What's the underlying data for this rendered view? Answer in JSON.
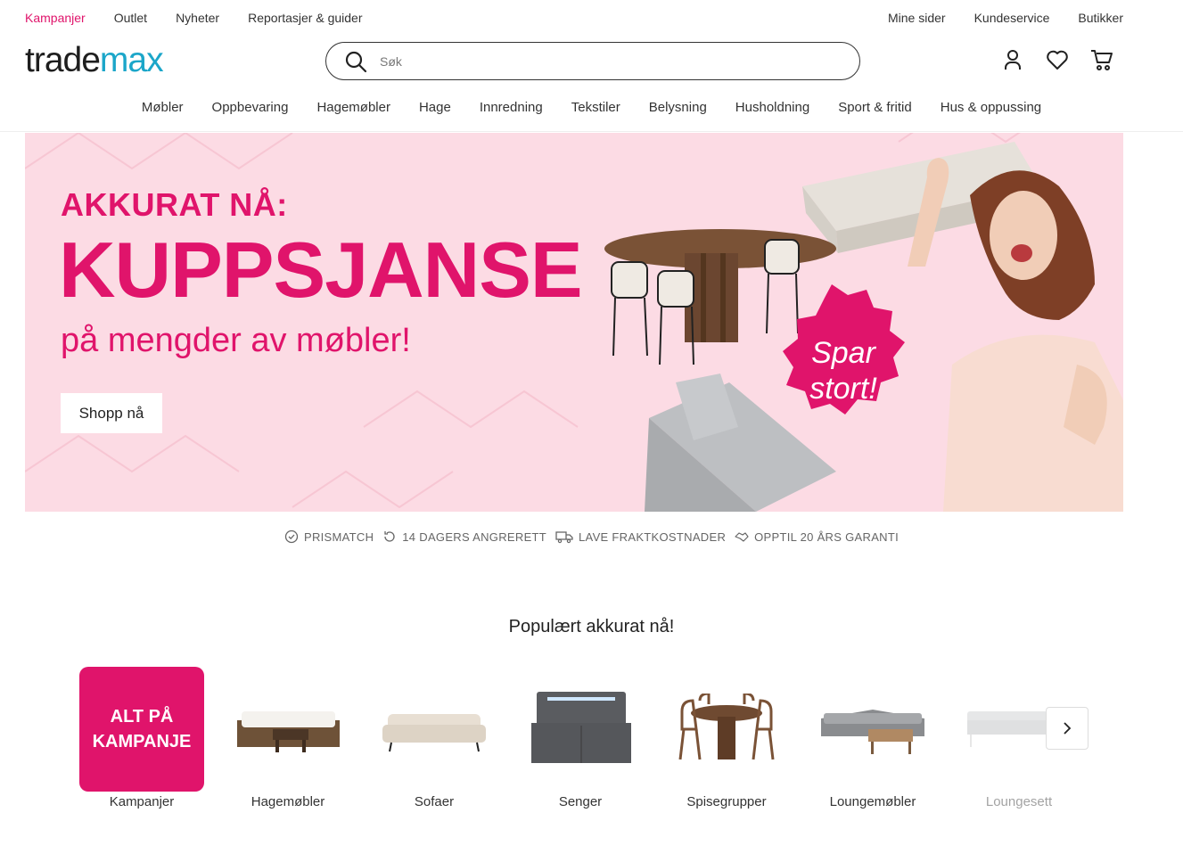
{
  "topbar": {
    "left_links": [
      "Kampanjer",
      "Outlet",
      "Nyheter",
      "Reportasjer & guider"
    ],
    "right_links": [
      "Mine sider",
      "Kundeservice",
      "Butikker"
    ]
  },
  "brand": {
    "logo_part1": "trade",
    "logo_part2": "max",
    "accent_color": "#1ba6c9",
    "brand_pink": "#e0146b"
  },
  "search": {
    "placeholder": "Søk",
    "value": ""
  },
  "header_icons": [
    "user-icon",
    "heart-icon",
    "cart-icon"
  ],
  "categories": [
    "Møbler",
    "Oppbevaring",
    "Hagemøbler",
    "Hage",
    "Innredning",
    "Tekstiler",
    "Belysning",
    "Husholdning",
    "Sport & fritid",
    "Hus & oppussing"
  ],
  "hero": {
    "kicker": "AKKURAT NÅ:",
    "headline": "KUPPSJANSE",
    "subline": "på mengder av møbler!",
    "cta": "Shopp nå",
    "badge_line1": "Spar",
    "badge_line2": "stort!",
    "bg_color": "#fcdbe4"
  },
  "usps": [
    {
      "icon": "check-circle-icon",
      "label": "PRISMATCH"
    },
    {
      "icon": "return-arrow-icon",
      "label": "14 DAGERS ANGRERETT"
    },
    {
      "icon": "truck-icon",
      "label": "LAVE FRAKTKOSTNADER"
    },
    {
      "icon": "handshake-icon",
      "label": "OPPTIL 20 ÅRS GARANTI"
    }
  ],
  "popular": {
    "title": "Populært akkurat nå!",
    "promo_tile_line1": "ALT PÅ",
    "promo_tile_line2": "KAMPANJE",
    "items": [
      "Kampanjer",
      "Hagemøbler",
      "Sofaer",
      "Senger",
      "Spisegrupper",
      "Loungemøbler",
      "Loungesett"
    ]
  }
}
